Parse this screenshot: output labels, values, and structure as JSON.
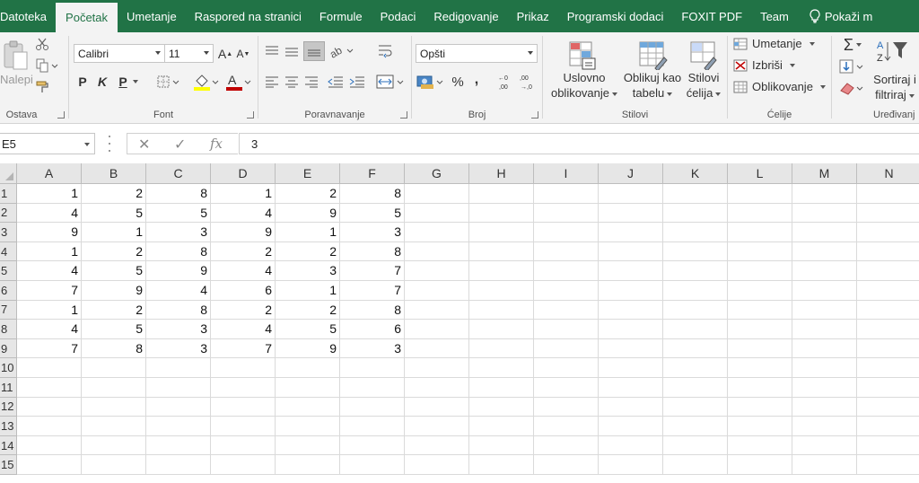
{
  "tabs": [
    {
      "label": "Datoteka",
      "active": false
    },
    {
      "label": "Početak",
      "active": true
    },
    {
      "label": "Umetanje",
      "active": false
    },
    {
      "label": "Raspored na stranici",
      "active": false
    },
    {
      "label": "Formule",
      "active": false
    },
    {
      "label": "Podaci",
      "active": false
    },
    {
      "label": "Redigovanje",
      "active": false
    },
    {
      "label": "Prikaz",
      "active": false
    },
    {
      "label": "Programski dodaci",
      "active": false
    },
    {
      "label": "FOXIT PDF",
      "active": false
    },
    {
      "label": "Team",
      "active": false
    }
  ],
  "tell_me": "Pokaži m",
  "ribbon": {
    "clipboard": {
      "paste": "Nalepi",
      "label": "Ostava"
    },
    "font": {
      "name": "Calibri",
      "size": "11",
      "label": "Font",
      "bold": "P",
      "italic": "K",
      "underline": "P"
    },
    "alignment": {
      "label": "Poravnavanje"
    },
    "number": {
      "format": "Opšti",
      "percent": "%",
      "comma": ",",
      "label": "Broj"
    },
    "styles": {
      "conditional_line1": "Uslovno",
      "conditional_line2": "oblikovanje",
      "table_line1": "Oblikuj kao",
      "table_line2": "tabelu",
      "cell_line1": "Stilovi",
      "cell_line2": "ćelija",
      "label": "Stilovi"
    },
    "cells": {
      "insert": "Umetanje",
      "delete": "Izbriši",
      "format": "Oblikovanje",
      "label": "Ćelije"
    },
    "editing": {
      "sort_line1": "Sortiraj i",
      "sort_line2": "filtriraj",
      "label": "Uređivanj"
    }
  },
  "formula_bar": {
    "name_box": "E5",
    "cancel": "✕",
    "enter": "✓",
    "fx": "fx",
    "content": "3"
  },
  "columns": [
    "A",
    "B",
    "C",
    "D",
    "E",
    "F",
    "G",
    "H",
    "I",
    "J",
    "K",
    "L",
    "M",
    "N"
  ],
  "rows": [
    "1",
    "2",
    "3",
    "4",
    "5",
    "6",
    "7",
    "8",
    "9",
    "10",
    "11",
    "12",
    "13",
    "14",
    "15"
  ],
  "cells": [
    [
      "1",
      "2",
      "8",
      "1",
      "2",
      "8"
    ],
    [
      "4",
      "5",
      "5",
      "4",
      "9",
      "5"
    ],
    [
      "9",
      "1",
      "3",
      "9",
      "1",
      "3"
    ],
    [
      "1",
      "2",
      "8",
      "2",
      "2",
      "8"
    ],
    [
      "4",
      "5",
      "9",
      "4",
      "3",
      "7"
    ],
    [
      "7",
      "9",
      "4",
      "6",
      "1",
      "7"
    ],
    [
      "1",
      "2",
      "8",
      "2",
      "2",
      "8"
    ],
    [
      "4",
      "5",
      "3",
      "4",
      "5",
      "6"
    ],
    [
      "7",
      "8",
      "3",
      "7",
      "9",
      "3"
    ]
  ],
  "colors": {
    "accent": "#217346",
    "ribbon_bg": "#f3f3f3",
    "header_bg": "#e6e6e6",
    "gridline": "#dadada"
  }
}
